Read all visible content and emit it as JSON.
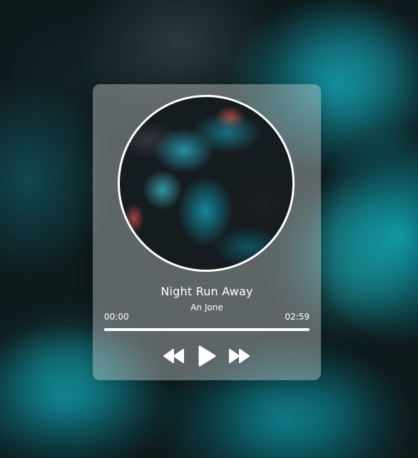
{
  "player": {
    "track_title": "Night Run Away",
    "artist": "An Jone",
    "elapsed": "00:00",
    "duration": "02:59",
    "progress": 1.0,
    "controls": {
      "rewind_icon": "rewind-icon",
      "play_icon": "play-icon",
      "forward_icon": "fast-forward-icon"
    }
  },
  "colors": {
    "accent": "#ffffff",
    "card": "#cdcdcd"
  }
}
